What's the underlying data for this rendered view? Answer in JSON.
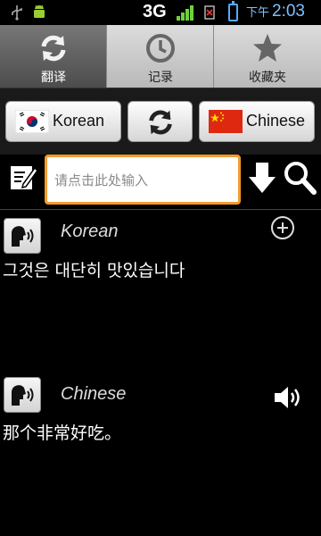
{
  "status": {
    "network": "3G",
    "ampm": "下午",
    "time": "2:03"
  },
  "tabs": [
    {
      "label": "翻译",
      "icon": "refresh-icon",
      "active": true
    },
    {
      "label": "记录",
      "icon": "clock-icon",
      "active": false
    },
    {
      "label": "收藏夹",
      "icon": "star-icon",
      "active": false
    }
  ],
  "languages": {
    "source": "Korean",
    "target": "Chinese"
  },
  "input": {
    "placeholder": "请点击此处输入",
    "value": ""
  },
  "source_result": {
    "language": "Korean",
    "text": "그것은 대단히 맛있습니다"
  },
  "target_result": {
    "language": "Chinese",
    "text": "那个非常好吃。"
  },
  "colors": {
    "accent": "#f39b2d",
    "clock": "#7ec0ff",
    "battery": "#5aa9ff"
  }
}
